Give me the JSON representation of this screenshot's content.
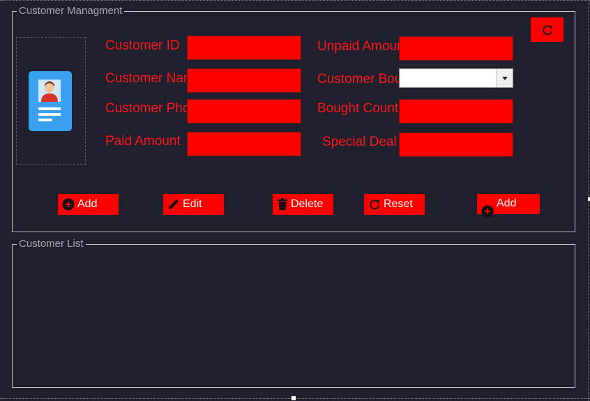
{
  "management": {
    "title": "Customer Managment",
    "left_labels": [
      "Customer ID",
      "Customer Name",
      "Customer Phone",
      "Paid Amount"
    ],
    "right_labels": [
      "Unpaid Amount",
      "Customer Bought",
      "Bought Count",
      "Special Deal"
    ],
    "left_values": [
      "",
      "",
      "",
      ""
    ],
    "right_values": [
      "",
      "",
      ""
    ],
    "combo_value": ""
  },
  "buttons": {
    "add": "Add",
    "edit": "Edit",
    "delete": "Delete",
    "reset": "Reset",
    "add2": "Add"
  },
  "list": {
    "title": "Customer List"
  },
  "icons": {
    "refresh": "refresh-icon",
    "add": "plus-circle-icon",
    "edit": "pencil-icon",
    "delete": "trash-icon",
    "reset": "refresh-icon",
    "photo": "id-card-icon"
  },
  "colors": {
    "background": "#201f2d",
    "accent": "#ff0000",
    "label_text": "#ff1a1a",
    "group_title": "#a9a9b2"
  }
}
